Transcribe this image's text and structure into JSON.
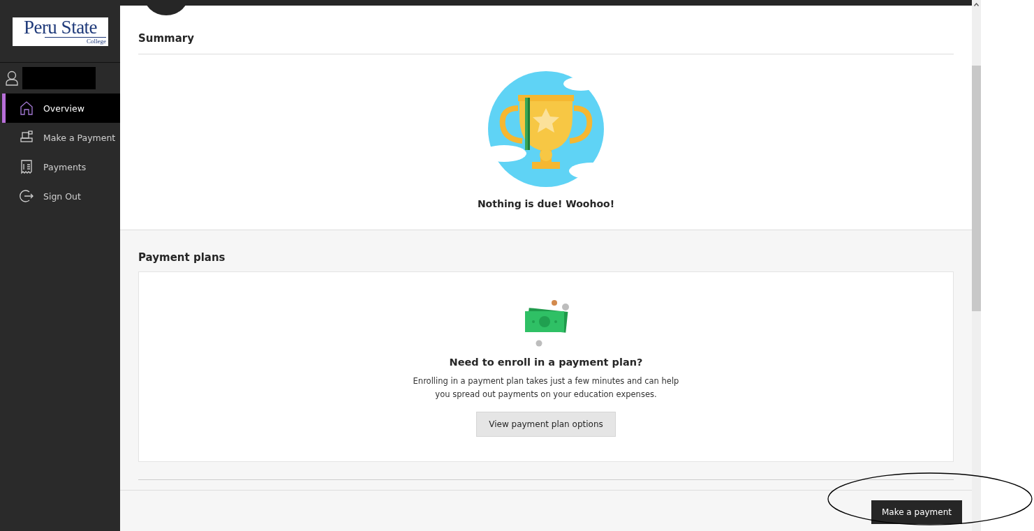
{
  "logo": {
    "name": "Peru State",
    "subtitle": "College"
  },
  "nav": [
    {
      "label": "Overview",
      "selected": true
    },
    {
      "label": "Make a Payment",
      "selected": false
    },
    {
      "label": "Payments",
      "selected": false
    },
    {
      "label": "Sign Out",
      "selected": false
    }
  ],
  "summary": {
    "title": "Summary",
    "message": "Nothing is due! Woohoo!"
  },
  "payment_plans": {
    "title": "Payment plans",
    "heading": "Need to enroll in a payment plan?",
    "text": "Enrolling in a payment plan takes just a few minutes and can help you spread out payments on your education expenses.",
    "button": "View payment plan options"
  },
  "footer": {
    "button": "Make a payment"
  }
}
